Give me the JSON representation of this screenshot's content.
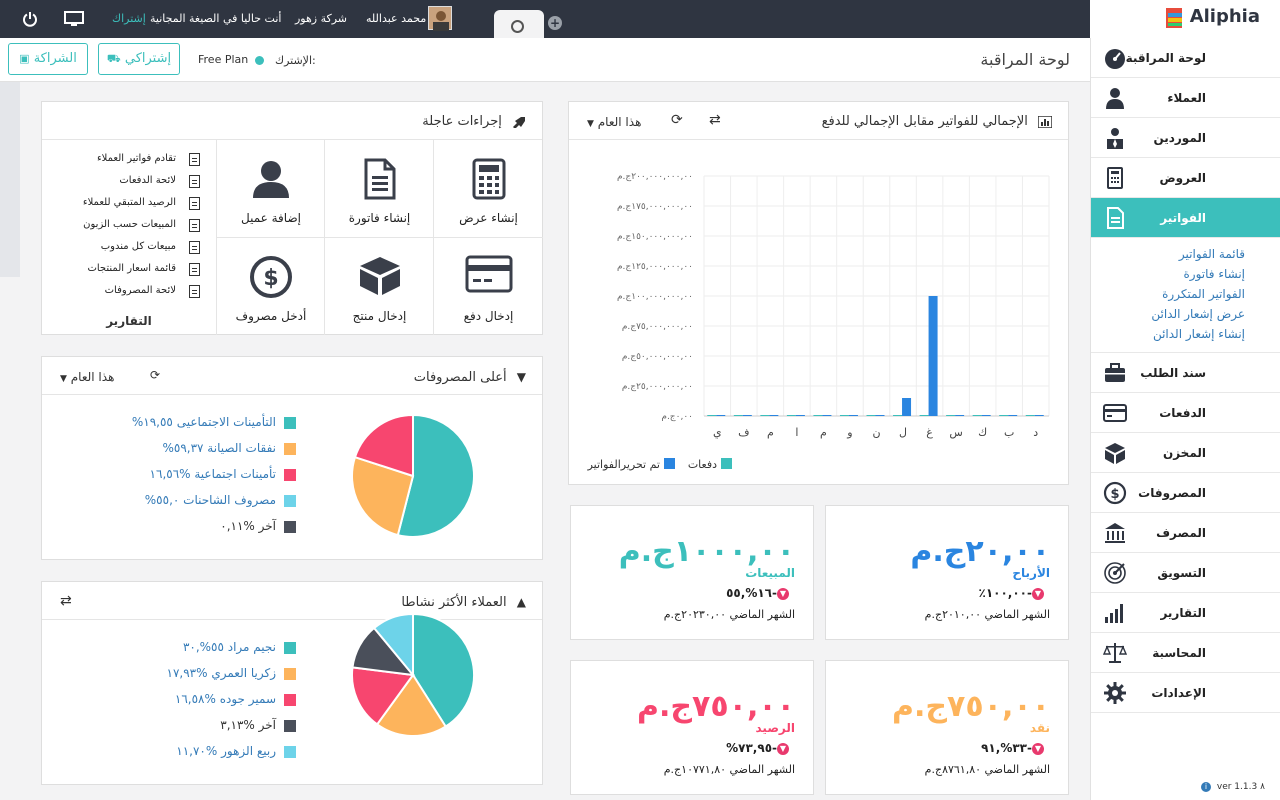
{
  "topbar": {
    "brand": "Aliphia",
    "user_name": "محمد عبدالله",
    "company": "شركة زهور",
    "plan_notice": "أنت حاليا في الصيغة المجانية",
    "subscribe_link": "إشتراك"
  },
  "header": {
    "page_title": "لوحة المراقبة",
    "plan_label": "الإشترك:",
    "plan_name": "Free Plan",
    "subscribe_button": "إشتراكي",
    "partner_button": "الشراكة"
  },
  "sidebar": {
    "items": [
      {
        "label": "لوحة المراقبة",
        "icon": "dashboard-icon"
      },
      {
        "label": "العملاء",
        "icon": "user-icon"
      },
      {
        "label": "الموردين",
        "icon": "supplier-icon"
      },
      {
        "label": "العروض",
        "icon": "calculator-icon"
      },
      {
        "label": "الفواتير",
        "icon": "invoice-icon"
      },
      {
        "label": "سند الطلب",
        "icon": "briefcase-icon"
      },
      {
        "label": "الدفعات",
        "icon": "credit-card-icon"
      },
      {
        "label": "المخزن",
        "icon": "box-icon"
      },
      {
        "label": "المصروفات",
        "icon": "dollar-icon"
      },
      {
        "label": "المصرف",
        "icon": "bank-icon"
      },
      {
        "label": "التسويق",
        "icon": "target-icon"
      },
      {
        "label": "التقارير",
        "icon": "bars-icon"
      },
      {
        "label": "المحاسبة",
        "icon": "scale-icon"
      },
      {
        "label": "الإعدادات",
        "icon": "gear-icon"
      }
    ],
    "invoice_sub": [
      "قائمة الفواتير",
      "إنشاء فاتورة",
      "الفواتير المتكررة",
      "عرض إشعار الدائن",
      "إنشاء إشعار الدائن"
    ],
    "version": "ver 1.1.3 ٨"
  },
  "quick_actions": {
    "title": "إجراءات عاجلة",
    "actions": [
      "إنشاء عرض",
      "إنشاء فاتورة",
      "إضافة عميل",
      "إدخال دفع",
      "إدخال منتج",
      "أدخل مصروف"
    ],
    "reports_title": "التقارير",
    "reports": [
      "تقادم فواتير العملاء",
      "لائحة الدفعات",
      "الرصيد المتبقي للعملاء",
      "المبيعات حسب الزبون",
      "مبيعات كل مندوب",
      "قائمة اسعار المنتجات",
      "لائحة المصروفات"
    ]
  },
  "expenses": {
    "title": "أعلى المصروفات",
    "period": "هذا العام",
    "legend": [
      {
        "label": "التأمينات الاجتماعيى ١٩,٥٥%",
        "color": "#3cbfbc",
        "value": 54.0
      },
      {
        "label": "نفقات الصيانة ٥٩,٣٧%",
        "color": "#fdb45c",
        "value": 26.0
      },
      {
        "label": "تأمينات اجتماعية %١٦,٥٦",
        "color": "#f7466f",
        "value": 20.0
      },
      {
        "label": "مصروف الشاحنات ٥٥,٠%",
        "color": "#6dd3e9",
        "value": 0
      },
      {
        "label": "آخر %٠,١١",
        "color": "#4a4f5a",
        "value": 0
      }
    ]
  },
  "customers": {
    "title": "العملاء الأكثر نشاطا",
    "legend": [
      {
        "label": "نجيم مراد ٥٥%,٣٠",
        "color": "#3cbfbc",
        "value": 41
      },
      {
        "label": "زكريا العمري %١٧,٩٣",
        "color": "#fdb45c",
        "value": 19
      },
      {
        "label": "سمير جوده %١٦,٥٨",
        "color": "#f7466f",
        "value": 17
      },
      {
        "label": "آخر %٣,١٣",
        "color": "#4a4f5a",
        "value": 12
      },
      {
        "label": "ربيع الزهور %١١,٧٠",
        "color": "#6dd3e9",
        "value": 11
      }
    ]
  },
  "chart_data": {
    "type": "bar",
    "title": "الإجمالي للفواتير مقابل الإجمالي للدفع",
    "period": "هذا العام",
    "categories": [
      "ي",
      "ف",
      "م",
      "ا",
      "م",
      "و",
      "ن",
      "ل",
      "غ",
      "س",
      "ك",
      "ب",
      "د"
    ],
    "y_ticks": [
      "٢٠٠,٠٠٠,٠٠٠,٠٠ج.م",
      "١٧٥,٠٠٠,٠٠٠,٠٠ج.م",
      "١٥٠,٠٠٠,٠٠٠,٠٠ج.م",
      "١٢٥,٠٠٠,٠٠٠,٠٠ج.م",
      "١٠٠,٠٠٠,٠٠٠,٠٠ج.م",
      "٧٥,٠٠٠,٠٠٠,٠٠ج.م",
      "٥٠,٠٠٠,٠٠٠,٠٠ج.م",
      "٢٥,٠٠٠,٠٠٠,٠٠ج.م",
      "٠,٠٠ج.م"
    ],
    "ylim": [
      0,
      200000000
    ],
    "series": [
      {
        "name": "تم تحريرالفواتير",
        "color": "#2a85e0",
        "values": [
          0,
          0,
          0,
          0,
          0,
          0,
          0,
          15000000,
          100000000,
          0,
          0,
          0,
          0
        ]
      },
      {
        "name": "دفعات",
        "color": "#3cbfbc",
        "values": [
          0,
          0,
          0,
          0,
          0,
          0,
          0,
          0,
          0,
          0,
          0,
          0,
          0
        ]
      }
    ]
  },
  "stats": [
    {
      "amount": "٢٠,٠٠ج.م",
      "name": "الأرباح",
      "pct": "٪١٠٠,٠٠-",
      "prev": "الشهر الماضي ٢٠١٠,٠٠ج.م",
      "color": "#2a85e0"
    },
    {
      "amount": "١٠٠٠,٠٠ج.م",
      "name": "المبيعات",
      "pct": "١٦%,٥٥-",
      "prev": "الشهر الماضي ٢٠٢٣٠,٠٠ج.م",
      "color": "#3cbfbc"
    },
    {
      "amount": "٧٥٠,٠٠ج.م",
      "name": "نقد",
      "pct": "٣٣%,٩١-",
      "prev": "الشهر الماضي ٨٧٦١,٨٠ج.م",
      "color": "#fdb45c"
    },
    {
      "amount": "٧٥٠,٠٠ج.م",
      "name": "الرصيد",
      "pct": "%٧٣,٩٥-",
      "prev": "الشهر الماضي ١٠٧٧١,٨٠ج.م",
      "color": "#f7466f"
    }
  ]
}
